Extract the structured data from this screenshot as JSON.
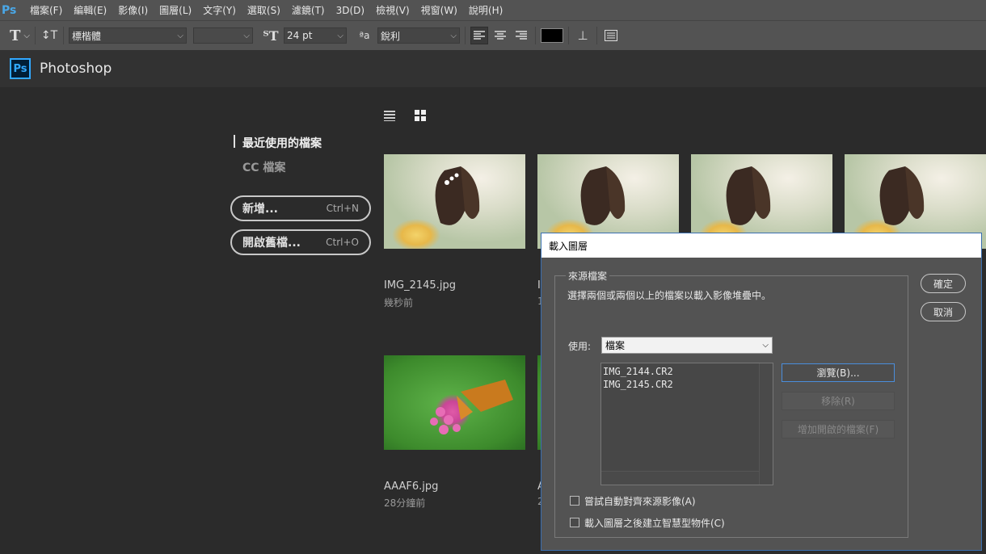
{
  "menubar": {
    "logo": "Ps",
    "items": [
      "檔案(F)",
      "編輯(E)",
      "影像(I)",
      "圖層(L)",
      "文字(Y)",
      "選取(S)",
      "濾鏡(T)",
      "3D(D)",
      "檢視(V)",
      "視窗(W)",
      "說明(H)"
    ]
  },
  "options": {
    "font_family": "標楷體",
    "font_style": "",
    "font_size": "24 pt",
    "antialias_label": "ªa",
    "antialias": "銳利",
    "text_color": "#000000"
  },
  "app": {
    "badge": "Ps",
    "title": "Photoshop"
  },
  "start": {
    "nav_recent": "最近使用的檔案",
    "nav_cc": "CC 檔案",
    "new_label": "新增...",
    "new_shortcut": "Ctrl+N",
    "open_label": "開啟舊檔...",
    "open_shortcut": "Ctrl+O",
    "files": [
      {
        "name": "IMG_2145.jpg",
        "time": "幾秒前"
      },
      {
        "name": "I",
        "time": "1"
      },
      {
        "name": "AAAF6.jpg",
        "time": "28分鐘前"
      },
      {
        "name": "A",
        "time": "2"
      }
    ]
  },
  "dialog": {
    "title": "載入圖層",
    "group_label": "來源檔案",
    "instruction": "選擇兩個或兩個以上的檔案以載入影像堆疊中。",
    "use_label": "使用:",
    "use_value": "檔案",
    "file_list": [
      "IMG_2144.CR2",
      "IMG_2145.CR2"
    ],
    "browse": "瀏覽(B)...",
    "remove": "移除(R)",
    "add_open": "增加開啟的檔案(F)",
    "ok": "確定",
    "cancel": "取消",
    "auto_align": "嘗試自動對齊來源影像(A)",
    "smart_object": "載入圖層之後建立智慧型物件(C)"
  }
}
